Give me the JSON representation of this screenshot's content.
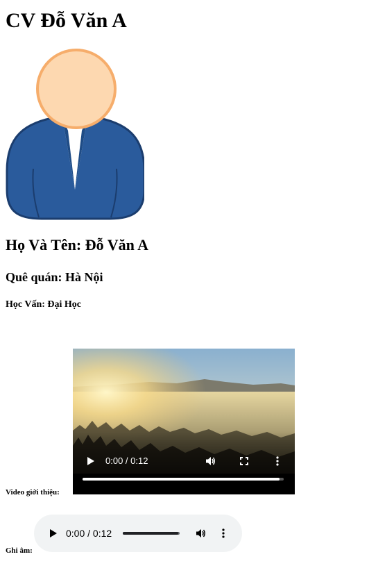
{
  "cv": {
    "title": "CV Đỗ Văn A",
    "full_name": "Họ Và Tên: Đỗ Văn A",
    "hometown": "Quê quán: Hà Nội",
    "education": "Học Vấn: Đại Học",
    "avatar_icon": "person-avatar-icon"
  },
  "video": {
    "label": "Video giới thiệu:",
    "time": "0:00 / 0:12",
    "progress_fraction": 0.98,
    "controls": {
      "play_icon": "play-icon",
      "volume_icon": "volume-icon",
      "fullscreen_icon": "fullscreen-icon",
      "more_icon": "more-vertical-icon"
    }
  },
  "audio": {
    "label": "Ghi âm:",
    "time": "0:00 / 0:12",
    "progress_fraction": 0.98,
    "controls": {
      "play_icon": "play-icon",
      "volume_icon": "volume-icon",
      "more_icon": "more-vertical-icon"
    }
  },
  "colors": {
    "avatar_face": "#fdd8b0",
    "avatar_face_outline": "#f6ad6b",
    "avatar_suit": "#2a5b9c",
    "audio_background": "#f1f3f4"
  }
}
